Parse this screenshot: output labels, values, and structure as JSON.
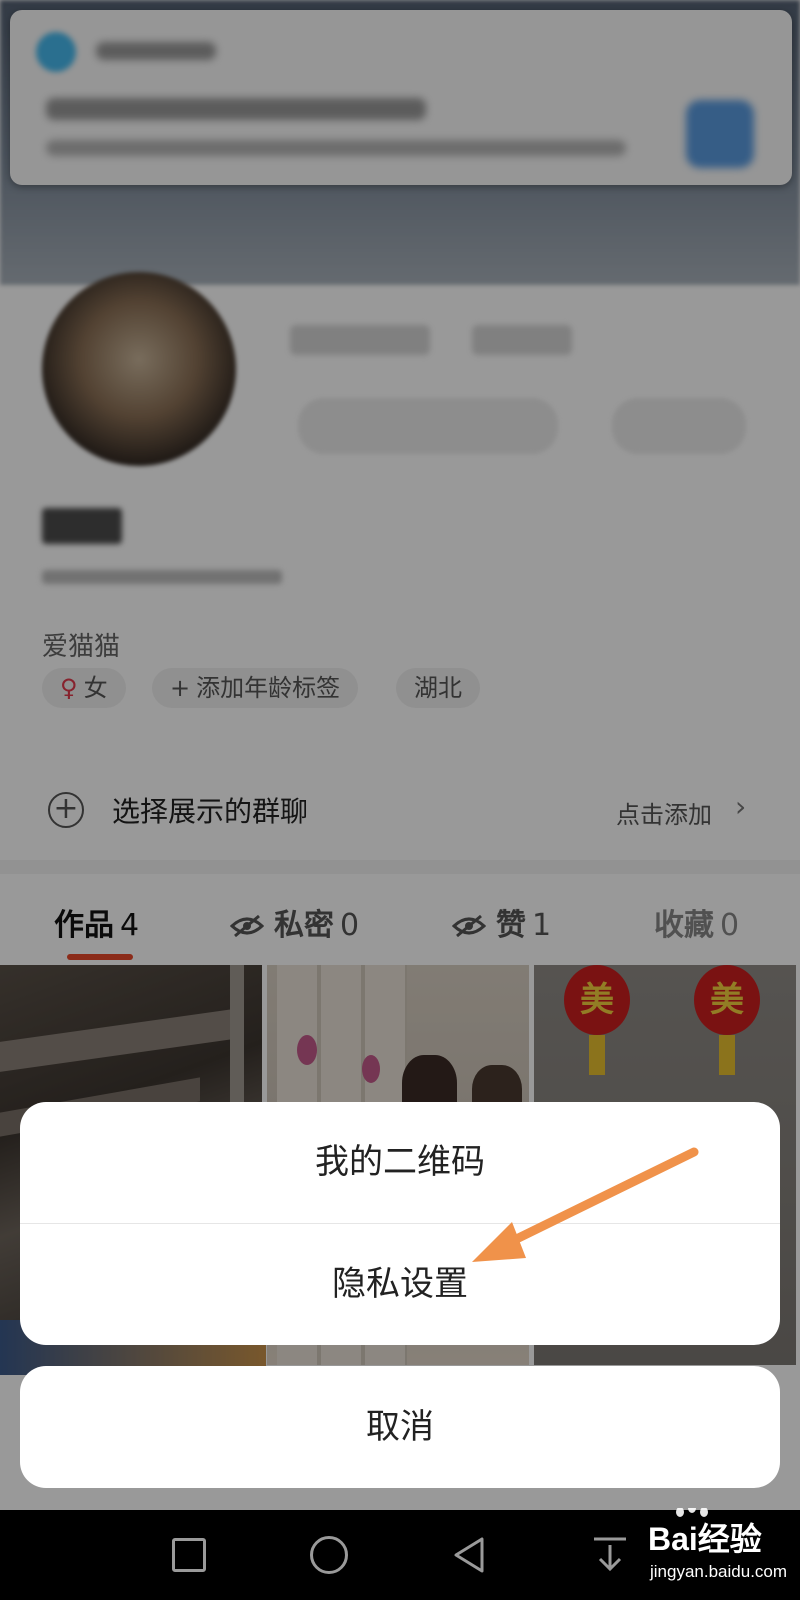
{
  "profile": {
    "bio": "爱猫猫",
    "tags": {
      "gender_symbol": "♀",
      "gender": "女",
      "add_age_plus": "+",
      "add_age": "添加年龄标签",
      "region": "湖北"
    }
  },
  "group_chat": {
    "plus": "+",
    "label": "选择展示的群聊",
    "action": "点击添加",
    "chevron": "›"
  },
  "tabs": [
    {
      "label": "作品",
      "count": "4"
    },
    {
      "label": "私密",
      "count": "0"
    },
    {
      "label": "赞",
      "count": "1"
    },
    {
      "label": "收藏",
      "count": "0"
    }
  ],
  "thumbnails": {
    "lantern_char": "美"
  },
  "action_sheet": {
    "items": [
      "我的二维码",
      "隐私设置"
    ],
    "cancel": "取消"
  },
  "watermark": {
    "brand": "Bai经验",
    "url": "jingyan.baidu.com"
  },
  "colors": {
    "accent": "#e8492a",
    "arrow": "#f0924a",
    "gender": "#e23b4e"
  },
  "icons": {
    "eye_off": "eye-off-icon",
    "nav": [
      "square-recent-icon",
      "circle-home-icon",
      "triangle-back-icon",
      "download-arrow-icon"
    ]
  }
}
